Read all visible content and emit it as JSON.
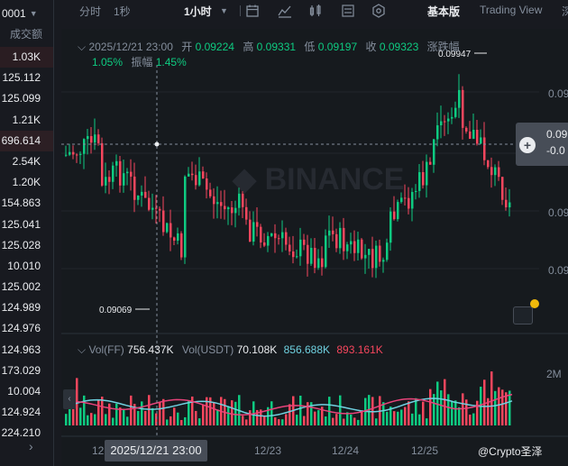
{
  "orderbook": {
    "header": "0001",
    "column_label": "成交额",
    "rows": [
      "1.03K",
      "125.112",
      "125.099",
      "1.21K",
      "696.614",
      "2.54K",
      "1.20K",
      "154.863",
      "125.041",
      "125.028",
      "10.010",
      "125.002",
      "124.989",
      "124.976",
      "124.963",
      "173.029",
      "10.004",
      "124.924",
      "224.210"
    ]
  },
  "toolbar": {
    "timeshare": "分时",
    "one_second": "1秒",
    "interval": "1小时",
    "basic": "基本版",
    "tradingview": "Trading View",
    "extra": "深"
  },
  "ohlc": {
    "datetime": "2025/12/21 23:00",
    "open_label": "开",
    "open": "0.09224",
    "high_label": "高",
    "high": "0.09331",
    "low_label": "低",
    "low": "0.09197",
    "close_label": "收",
    "close": "0.09323",
    "change_label": "涨跌幅",
    "change": "1.05%",
    "amp_label": "振幅",
    "amp": "1.45%"
  },
  "volume_legend": {
    "vol_ff_label": "Vol(FF)",
    "vol_ff": "756.437K",
    "vol_usdt_label": "Vol(USDT)",
    "vol_usdt": "70.108K",
    "ma1": "856.688K",
    "ma2": "893.161K"
  },
  "axis": {
    "price_ticks": [
      "0.09",
      "0.09",
      "0.09",
      "0.09"
    ],
    "vol_tick": "2M",
    "dates": [
      "12",
      "12/23",
      "12/24",
      "12/25"
    ],
    "crosshair_date": "2025/12/21 23:00",
    "price_tag_top": "0.09",
    "price_tag_bottom": "-0.0"
  },
  "annotations": {
    "low_price": "0.09069",
    "high_price": "0.09947"
  },
  "watermark": "@Crypto圣泽",
  "colors": {
    "up": "#0ecb81",
    "down": "#f6465d",
    "bg": "#161a1e",
    "ma_cyan": "#6fd1e0",
    "ma_pink": "#e8437a"
  }
}
